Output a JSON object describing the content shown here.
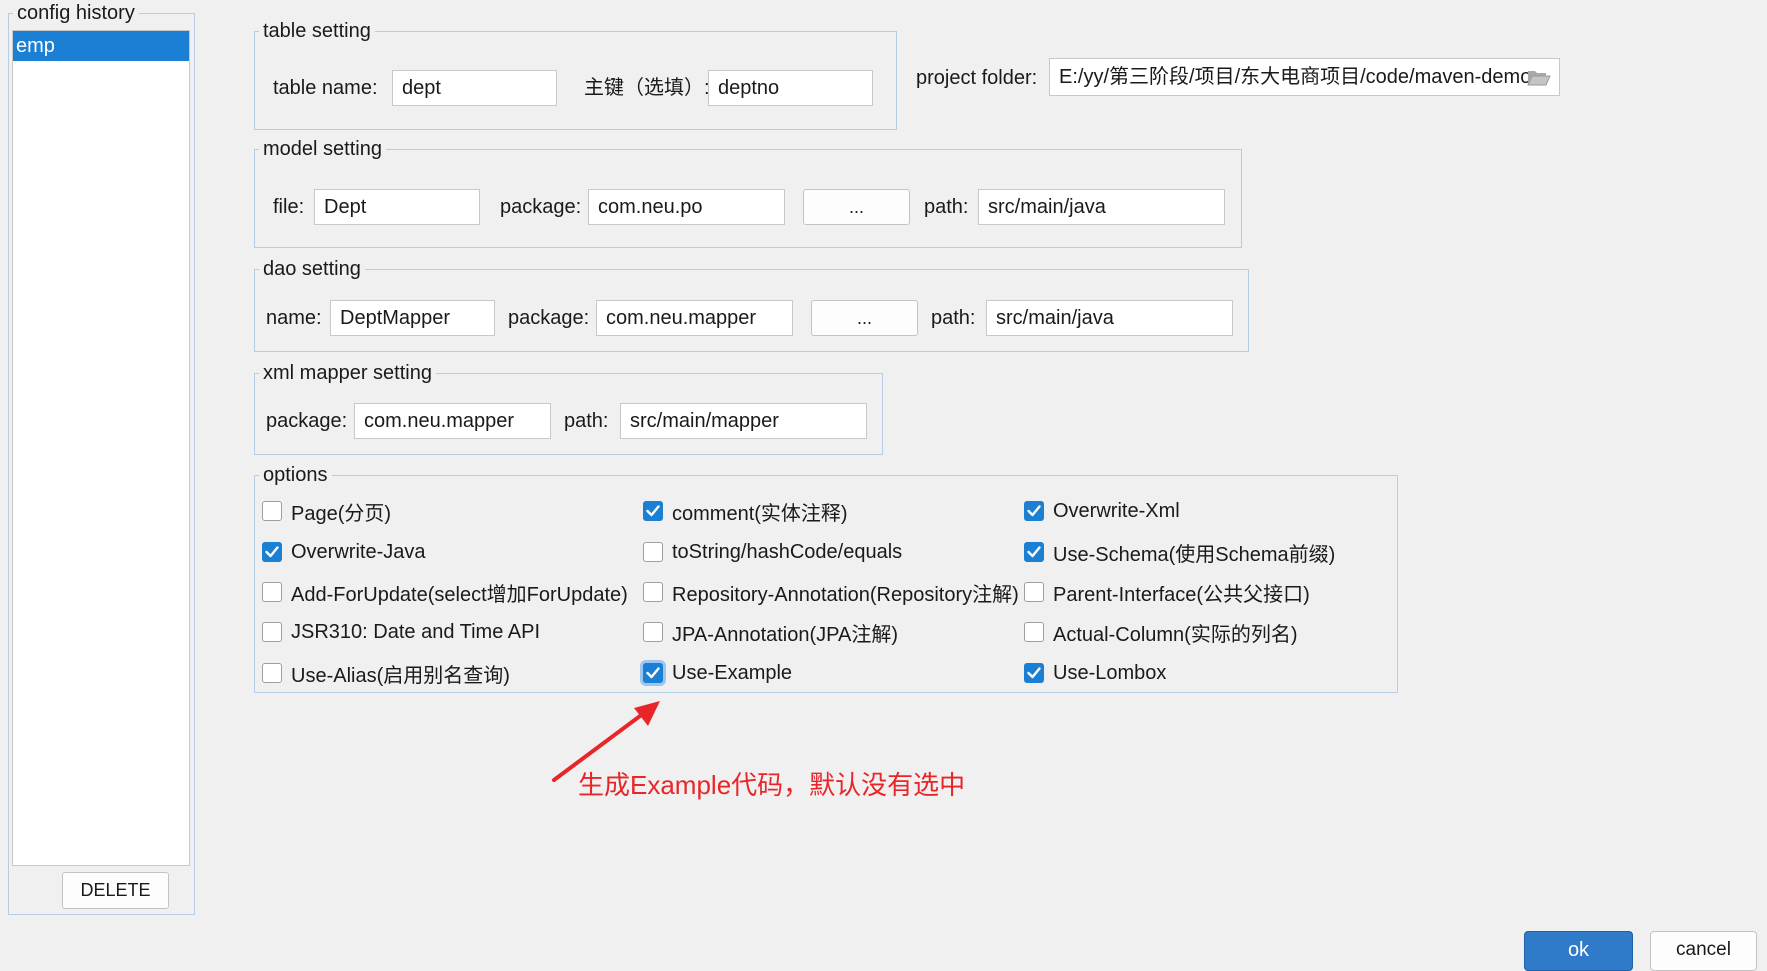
{
  "config_history": {
    "legend": "config history",
    "items": [
      {
        "label": "emp",
        "selected": true
      }
    ],
    "delete_label": "DELETE"
  },
  "table_setting": {
    "legend": "table setting",
    "table_name_label": "table  name:",
    "table_name_value": "dept",
    "pk_label": "主键（选填）:",
    "pk_value": "deptno"
  },
  "project_folder": {
    "label": "project folder:",
    "value": "E:/yy/第三阶段/项目/东大电商项目/code/maven-demo",
    "icon": "folder-icon"
  },
  "model_setting": {
    "legend": "model setting",
    "file_label": "file:",
    "file_value": "Dept",
    "package_label": "package:",
    "package_value": "com.neu.po",
    "browse_label": "...",
    "path_label": "path:",
    "path_value": "src/main/java"
  },
  "dao_setting": {
    "legend": "dao setting",
    "name_label": "name:",
    "name_value": "DeptMapper",
    "package_label": "package:",
    "package_value": "com.neu.mapper",
    "browse_label": "...",
    "path_label": "path:",
    "path_value": "src/main/java"
  },
  "xml_mapper_setting": {
    "legend": "xml mapper setting",
    "package_label": "package:",
    "package_value": "com.neu.mapper",
    "path_label": "path:",
    "path_value": "src/main/mapper"
  },
  "options": {
    "legend": "options",
    "items": [
      {
        "label": "Page(分页)",
        "checked": false
      },
      {
        "label": "comment(实体注释)",
        "checked": true
      },
      {
        "label": "Overwrite-Xml",
        "checked": true
      },
      {
        "label": "Overwrite-Java",
        "checked": true
      },
      {
        "label": "toString/hashCode/equals",
        "checked": false
      },
      {
        "label": "Use-Schema(使用Schema前缀)",
        "checked": true
      },
      {
        "label": "Add-ForUpdate(select增加ForUpdate)",
        "checked": false
      },
      {
        "label": "Repository-Annotation(Repository注解)",
        "checked": false
      },
      {
        "label": "Parent-Interface(公共父接口)",
        "checked": false
      },
      {
        "label": "JSR310: Date and Time API",
        "checked": false
      },
      {
        "label": "JPA-Annotation(JPA注解)",
        "checked": false
      },
      {
        "label": "Actual-Column(实际的列名)",
        "checked": false
      },
      {
        "label": "Use-Alias(启用别名查询)",
        "checked": false
      },
      {
        "label": "Use-Example",
        "checked": true,
        "focused": true
      },
      {
        "label": "Use-Lombox",
        "checked": true
      }
    ]
  },
  "annotation": {
    "text": "生成Example代码，默认没有选中",
    "color": "#e8262a"
  },
  "footer": {
    "ok_label": "ok",
    "cancel_label": "cancel"
  },
  "colors": {
    "accent": "#1b7fd4",
    "border": "#b7cde6"
  }
}
